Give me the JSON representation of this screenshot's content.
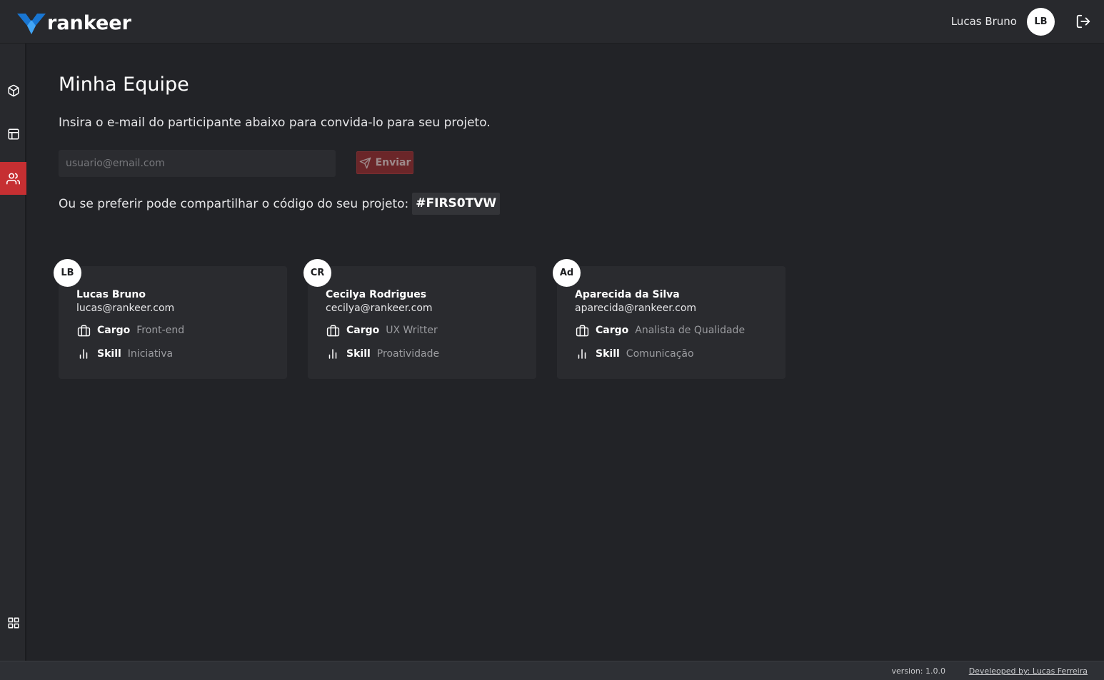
{
  "header": {
    "logo_text": "rankeer",
    "user_name": "Lucas Bruno",
    "user_initials": "LB",
    "logout_icon": "logout-icon"
  },
  "sidebar": {
    "items": [
      {
        "icon": "cube-icon",
        "active": false
      },
      {
        "icon": "layout-icon",
        "active": false
      },
      {
        "icon": "users-icon",
        "active": true
      },
      {
        "icon": "grid-icon",
        "active": false
      }
    ]
  },
  "main": {
    "title": "Minha Equipe",
    "description": "Insira o e-mail do participante abaixo para convida-lo para seu projeto.",
    "email_placeholder": "usuario@email.com",
    "email_value": "",
    "send_label": "Enviar",
    "share_text": "Ou se preferir pode compartilhar o código do seu projeto:",
    "project_code": "#FIRS0TVW"
  },
  "members": [
    {
      "initials": "LB",
      "name": "Lucas Bruno",
      "email": "lucas@rankeer.com",
      "cargo_label": "Cargo",
      "cargo": "Front-end",
      "skill_label": "Skill",
      "skill": "Iniciativa"
    },
    {
      "initials": "CR",
      "name": "Cecilya Rodrigues",
      "email": "cecilya@rankeer.com",
      "cargo_label": "Cargo",
      "cargo": "UX Writter",
      "skill_label": "Skill",
      "skill": "Proatividade"
    },
    {
      "initials": "Ad",
      "name": "Aparecida da Silva",
      "email": "aparecida@rankeer.com",
      "cargo_label": "Cargo",
      "cargo": "Analista de Qualidade",
      "skill_label": "Skill",
      "skill": "Comunicação"
    }
  ],
  "footer": {
    "version": "version: 1.0.0",
    "developer": "Develeoped by: Lucas Ferreira"
  },
  "colors": {
    "background": "#222327",
    "panel": "#28292d",
    "accent": "#c62f32",
    "logo_blue": "#1e88e5"
  }
}
